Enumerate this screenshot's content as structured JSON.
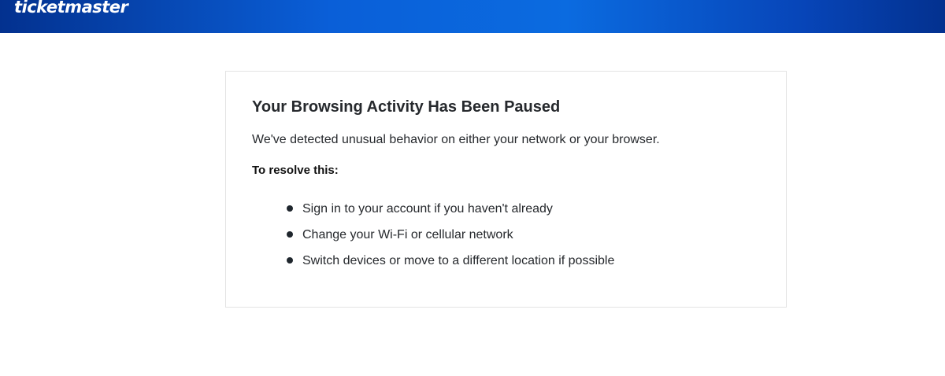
{
  "header": {
    "logo_text": "ticketmaster",
    "gradient_colors": [
      "#03318f",
      "#0a5fd8",
      "#0b6be0",
      "#03318f"
    ]
  },
  "notice": {
    "title": "Your Browsing Activity Has Been Paused",
    "description": "We've detected unusual behavior on either your network or your browser.",
    "resolve_heading": "To resolve this:",
    "steps": [
      {
        "label": "Sign in to your account if you haven't already"
      },
      {
        "label": "Change your Wi-Fi or cellular network"
      },
      {
        "label": "Switch devices or move to a different location if possible"
      }
    ]
  }
}
